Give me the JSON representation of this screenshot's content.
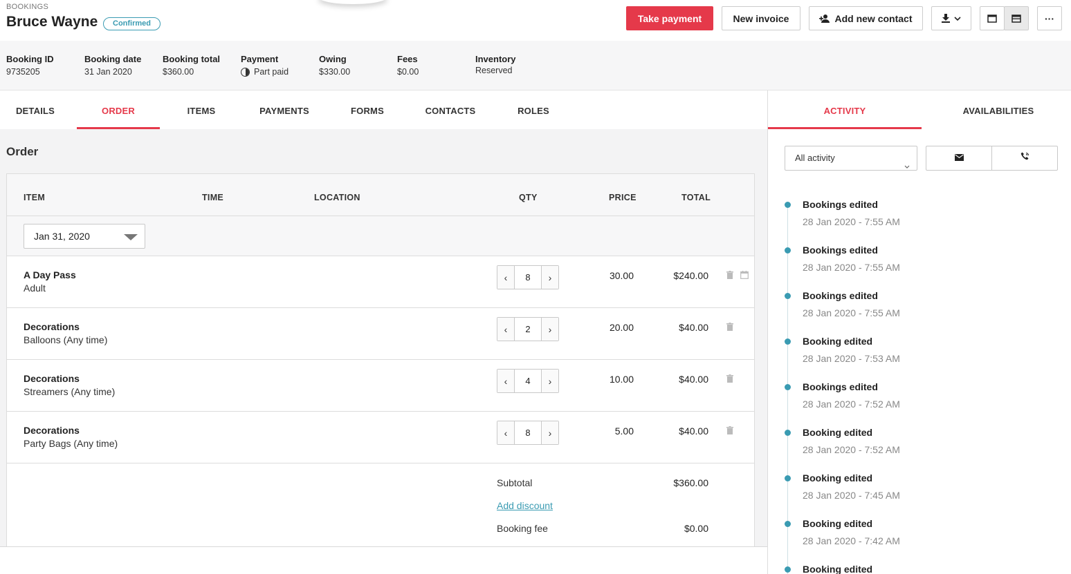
{
  "header": {
    "breadcrumb": "BOOKINGS",
    "title": "Bruce Wayne",
    "status": "Confirmed",
    "take_payment": "Take payment",
    "new_invoice": "New invoice",
    "add_contact": "Add new contact",
    "more": "···"
  },
  "summary": {
    "booking_id_label": "Booking ID",
    "booking_id": "9735205",
    "booking_date_label": "Booking date",
    "booking_date": "31 Jan 2020",
    "booking_total_label": "Booking total",
    "booking_total": "$360.00",
    "payment_label": "Payment",
    "payment": "Part paid",
    "owing_label": "Owing",
    "owing": "$330.00",
    "fees_label": "Fees",
    "fees": "$0.00",
    "inventory_label": "Inventory",
    "inventory": "Reserved"
  },
  "tabs": [
    "DETAILS",
    "ORDER",
    "ITEMS",
    "PAYMENTS",
    "FORMS",
    "CONTACTS",
    "ROLES"
  ],
  "order": {
    "title": "Order",
    "columns": {
      "item": "ITEM",
      "time": "TIME",
      "location": "LOCATION",
      "qty": "QTY",
      "price": "PRICE",
      "total": "TOTAL"
    },
    "date": "Jan 31, 2020",
    "rows": [
      {
        "name": "A Day Pass",
        "sub": "Adult",
        "qty": "8",
        "price": "30.00",
        "total": "$240.00"
      },
      {
        "name": "Decorations",
        "sub": "Balloons (Any time)",
        "qty": "2",
        "price": "20.00",
        "total": "$40.00"
      },
      {
        "name": "Decorations",
        "sub": "Streamers (Any time)",
        "qty": "4",
        "price": "10.00",
        "total": "$40.00"
      },
      {
        "name": "Decorations",
        "sub": "Party Bags (Any time)",
        "qty": "8",
        "price": "5.00",
        "total": "$40.00"
      }
    ],
    "subtotal_label": "Subtotal",
    "subtotal": "$360.00",
    "add_discount": "Add discount",
    "booking_fee_label": "Booking fee",
    "booking_fee": "$0.00"
  },
  "right": {
    "tabs": [
      "ACTIVITY",
      "AVAILABILITIES"
    ],
    "filter": "All activity",
    "events": [
      {
        "title": "Bookings edited",
        "time": "28 Jan 2020 - 7:55 AM"
      },
      {
        "title": "Bookings edited",
        "time": "28 Jan 2020 - 7:55 AM"
      },
      {
        "title": "Bookings edited",
        "time": "28 Jan 2020 - 7:55 AM"
      },
      {
        "title": "Booking edited",
        "time": "28 Jan 2020 - 7:53 AM"
      },
      {
        "title": "Bookings edited",
        "time": "28 Jan 2020 - 7:52 AM"
      },
      {
        "title": "Booking edited",
        "time": "28 Jan 2020 - 7:52 AM"
      },
      {
        "title": "Booking edited",
        "time": "28 Jan 2020 - 7:45 AM"
      },
      {
        "title": "Booking edited",
        "time": "28 Jan 2020 - 7:42 AM"
      },
      {
        "title": "Booking edited",
        "time": ""
      }
    ]
  },
  "colors": {
    "accent": "#e5394a",
    "teal": "#3a9bb2"
  },
  "icons": [
    "add-contact-icon",
    "download-icon",
    "chevron-down-icon",
    "single-pane-icon",
    "split-pane-icon",
    "more-icon",
    "trash-icon",
    "calendar-icon",
    "email-icon",
    "phone-icon"
  ]
}
